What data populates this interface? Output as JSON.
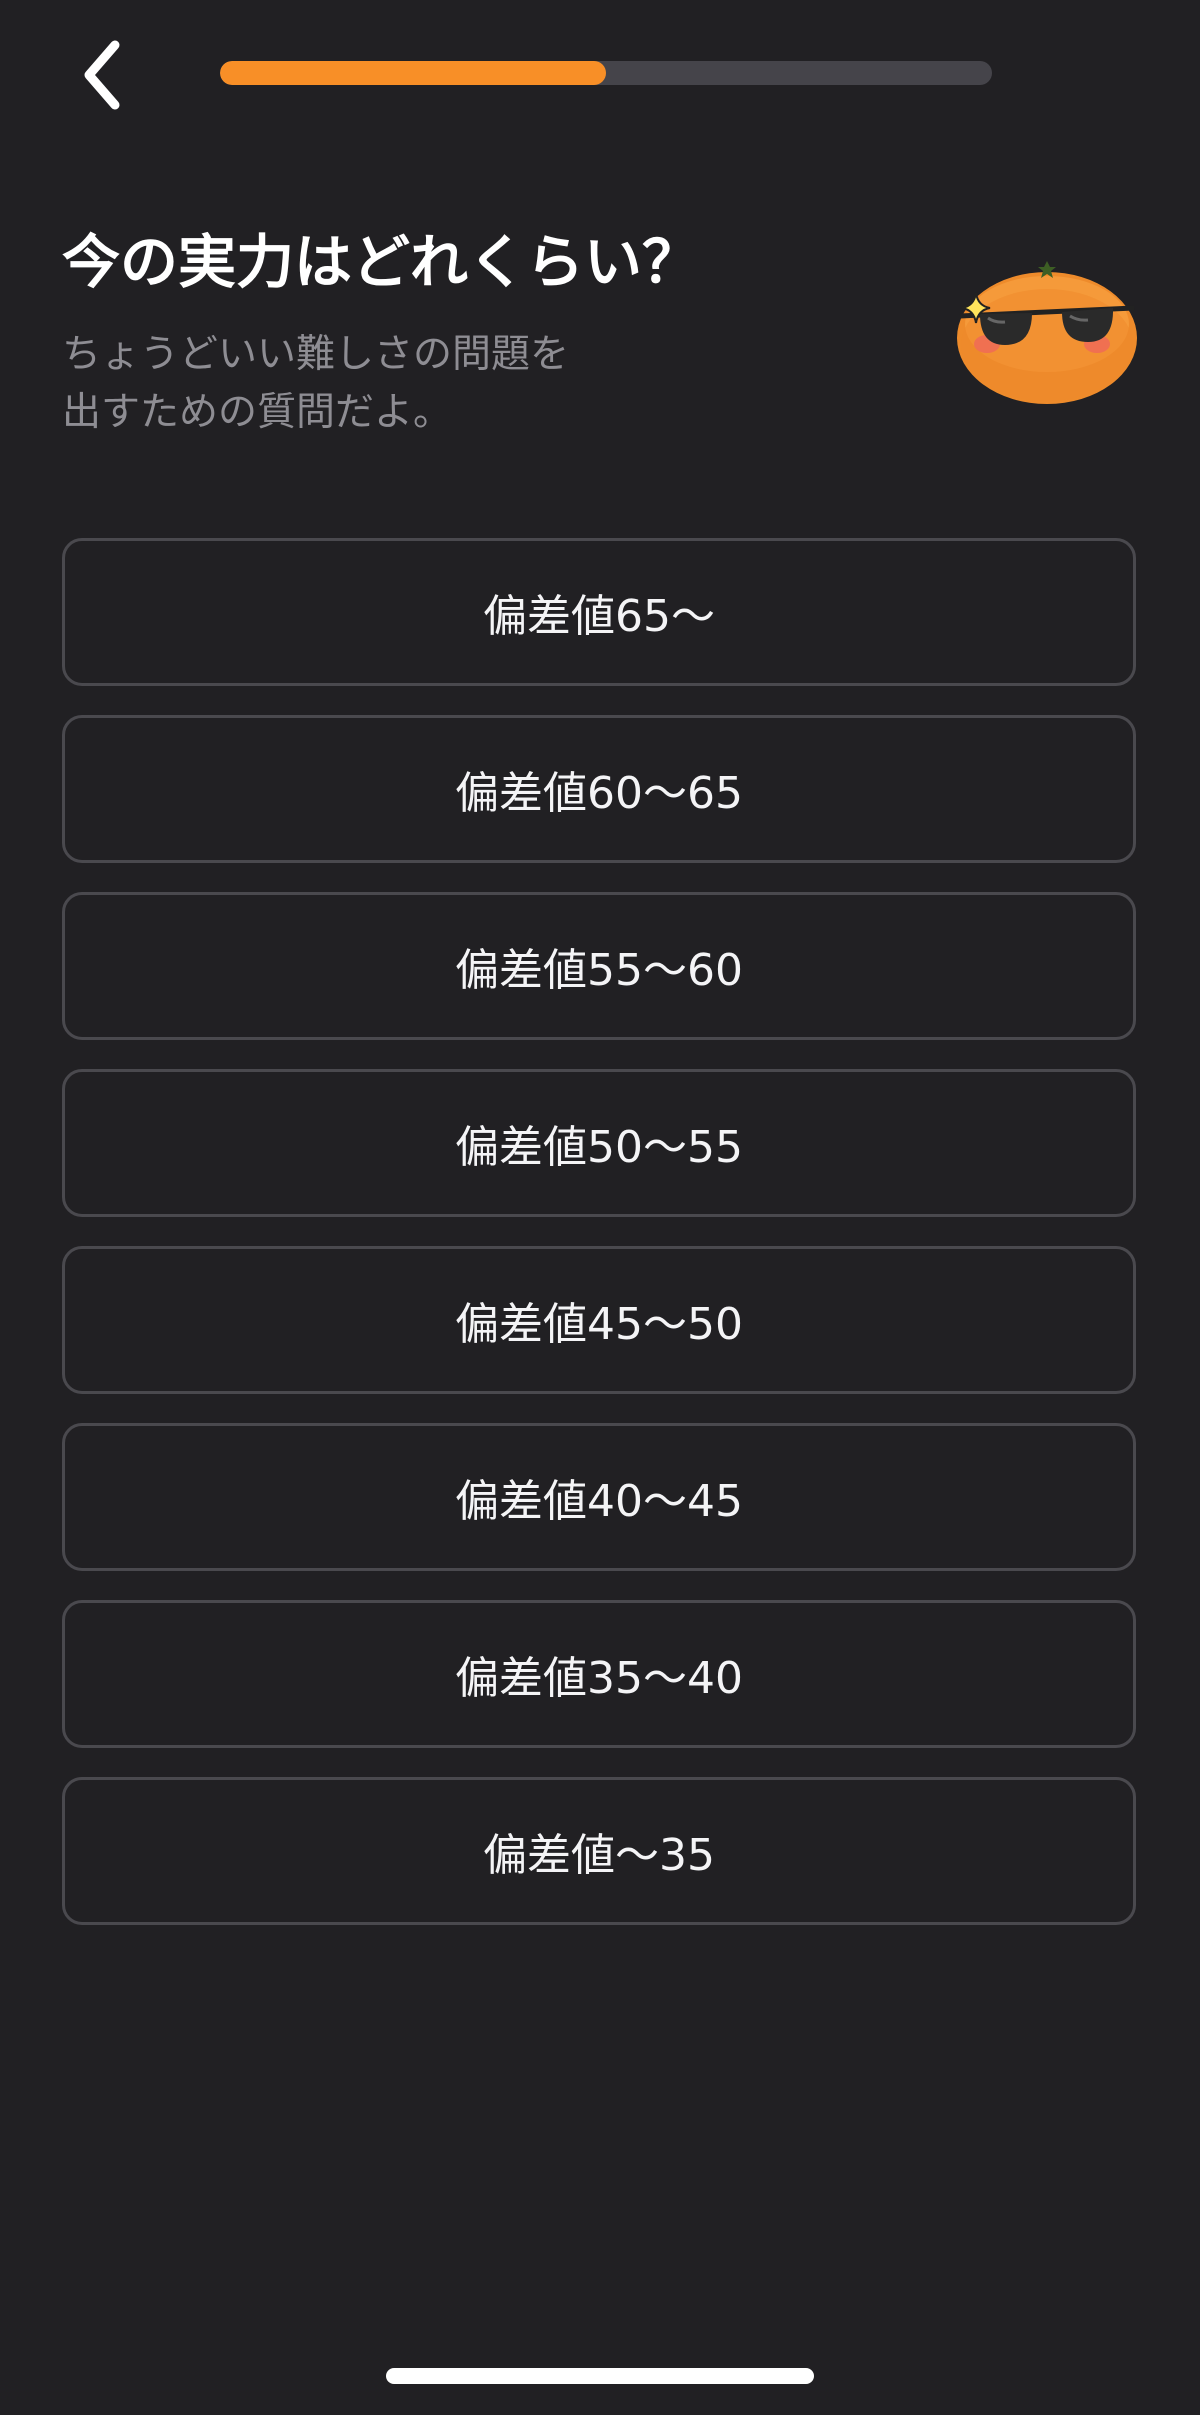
{
  "header": {
    "back_icon": "chevron-left-icon",
    "progress": 0.5,
    "progress_color": "#f88f27",
    "track_color": "#45444a"
  },
  "question": {
    "title": "今の実力はどれくらい？",
    "subtitle_line1": "ちょうどいい難しさの問題を",
    "subtitle_line2": "出すための質問だよ。",
    "mascot_icon": "orange-sunglasses-mascot"
  },
  "options": [
    {
      "label": "偏差値65～"
    },
    {
      "label": "偏差値60～65"
    },
    {
      "label": "偏差値55～60"
    },
    {
      "label": "偏差値50～55"
    },
    {
      "label": "偏差値45～50"
    },
    {
      "label": "偏差値40～45"
    },
    {
      "label": "偏差値35～40"
    },
    {
      "label": "偏差値～35"
    }
  ],
  "colors": {
    "background": "#212023",
    "border": "#4a494e",
    "subtitle": "#8e8d93",
    "accent": "#f88f27"
  }
}
